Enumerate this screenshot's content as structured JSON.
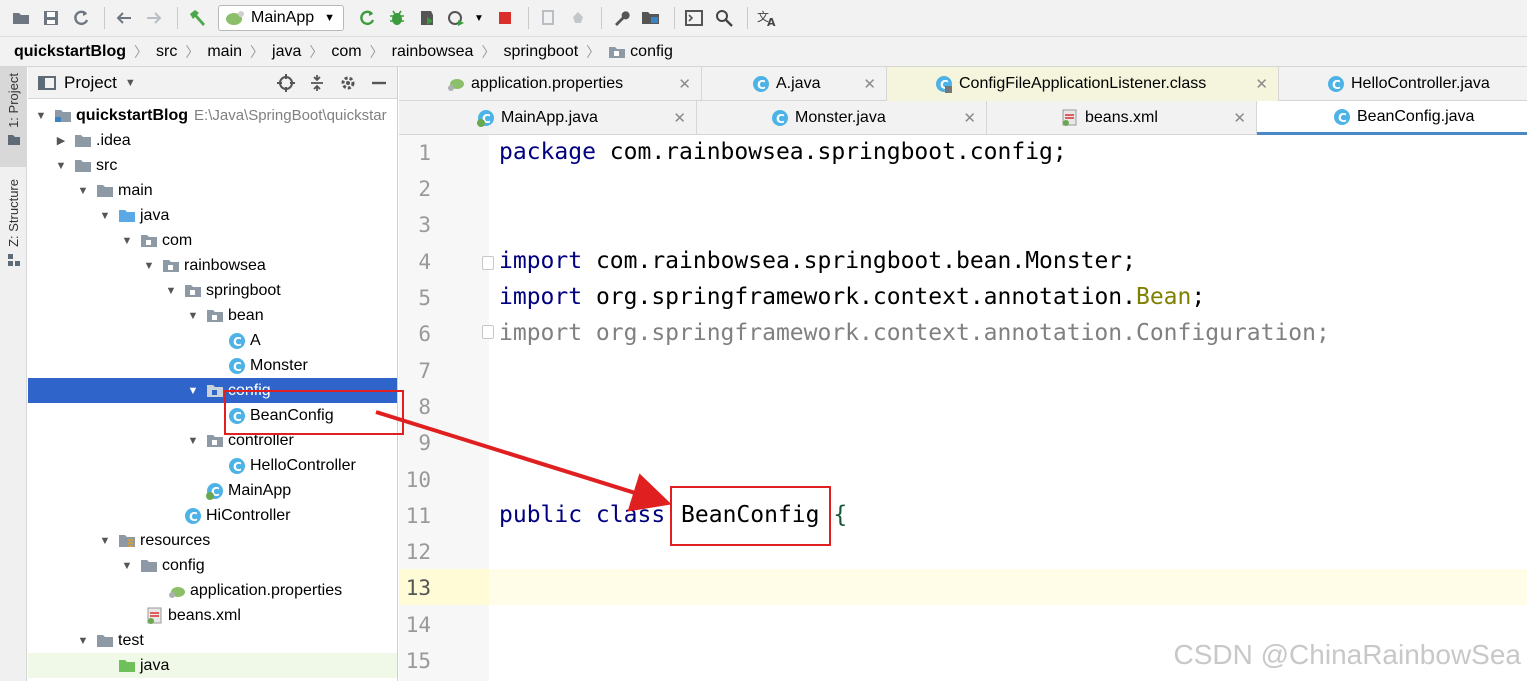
{
  "toolbar": {
    "run_config": "MainApp",
    "icons": [
      "open-folder-icon",
      "save-icon",
      "sync-icon",
      "back-icon",
      "forward-icon",
      "build-hammer-icon",
      "run-icon",
      "debug-bug-icon",
      "coverage-icon",
      "profile-icon",
      "stop-icon",
      "attach-icon",
      "pin-icon",
      "settings-wrench-icon",
      "project-structure-icon",
      "terminal-icon",
      "search-icon",
      "translate-icon"
    ]
  },
  "breadcrumb": [
    "quickstartBlog",
    "src",
    "main",
    "java",
    "com",
    "rainbowsea",
    "springboot",
    "config"
  ],
  "stripe": {
    "project_tab": "1: Project",
    "structure_tab": "Z: Structure"
  },
  "project_panel": {
    "title": "Project",
    "root_path": "E:\\Java\\SpringBoot\\quickstar",
    "tree": [
      {
        "label": "quickstartBlog",
        "bold": true
      },
      {
        "label": ".idea"
      },
      {
        "label": "src"
      },
      {
        "label": "main"
      },
      {
        "label": "java"
      },
      {
        "label": "com"
      },
      {
        "label": "rainbowsea"
      },
      {
        "label": "springboot"
      },
      {
        "label": "bean"
      },
      {
        "label": "A"
      },
      {
        "label": "Monster"
      },
      {
        "label": "config"
      },
      {
        "label": "BeanConfig"
      },
      {
        "label": "controller"
      },
      {
        "label": "HelloController"
      },
      {
        "label": "MainApp"
      },
      {
        "label": "HiController"
      },
      {
        "label": "resources"
      },
      {
        "label": "config"
      },
      {
        "label": "application.properties"
      },
      {
        "label": "beans.xml"
      },
      {
        "label": "test"
      },
      {
        "label": "java"
      }
    ]
  },
  "editor": {
    "tabs_row1": [
      "application.properties",
      "A.java",
      "ConfigFileApplicationListener.class",
      "HelloController.java"
    ],
    "tabs_row2": [
      "MainApp.java",
      "Monster.java",
      "beans.xml",
      "BeanConfig.java"
    ],
    "line_numbers": [
      "1",
      "2",
      "3",
      "4",
      "5",
      "6",
      "7",
      "8",
      "9",
      "10",
      "11",
      "12",
      "13",
      "14",
      "15"
    ],
    "code": {
      "l1_kw": "package",
      "l1_rest": " com.rainbowsea.springboot.config;",
      "l4_kw": "import",
      "l4_rest": " com.rainbowsea.springboot.bean.Monster;",
      "l5_kw": "import",
      "l5_rest": " org.springframework.context.annotation.",
      "l5_ann": "Bean",
      "l5_end": ";",
      "l6_text": "import org.springframework.context.annotation.Configuration;",
      "l11_kw": "public class",
      "l11_name": "BeanConfig",
      "l11_brace": "{"
    }
  },
  "watermark": "CSDN @ChinaRainbowSea",
  "colors": {
    "selection": "#2f65ca",
    "keyword": "#000080",
    "annotation": "#808000",
    "highlight_box": "#e02020"
  }
}
